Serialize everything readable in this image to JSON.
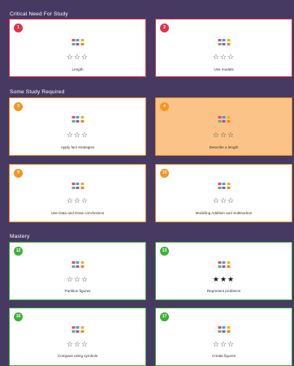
{
  "sections": [
    {
      "title": "Critical  Need  For  Study"
    },
    {
      "title": "Some  Study  Required"
    },
    {
      "title": "Mastery"
    }
  ],
  "icon": "common-core-standards-icon",
  "star_empty": "☆",
  "star_full": "★",
  "colors": {
    "background": "#463a63",
    "critical": "#e0344a",
    "some_study": "#f08a1c",
    "mastery": "#3cb236",
    "highlight": "#fbc387"
  },
  "cards": [
    {
      "number": "1",
      "label": "Length",
      "stars_filled": 0
    },
    {
      "number": "2",
      "label": "Use models",
      "stars_filled": 0
    },
    {
      "number": "3",
      "label": "Apply fact strategies",
      "stars_filled": 0
    },
    {
      "number": "4",
      "label": "Describe a length",
      "stars_filled": 0
    },
    {
      "number": "9",
      "label": "Use  Data  and  Draw conclusions",
      "stars_filled": 0
    },
    {
      "number": "10",
      "label": "Modeling Addition and Subtraction",
      "stars_filled": 0
    },
    {
      "number": "12",
      "label": "Partition figures",
      "stars_filled": 0
    },
    {
      "number": "13",
      "label": "Represent problems",
      "stars_filled": 3
    },
    {
      "number": "16",
      "label": "Compare using symbols",
      "stars_filled": 0
    },
    {
      "number": "17",
      "label": "Create figures",
      "stars_filled": 0
    }
  ]
}
